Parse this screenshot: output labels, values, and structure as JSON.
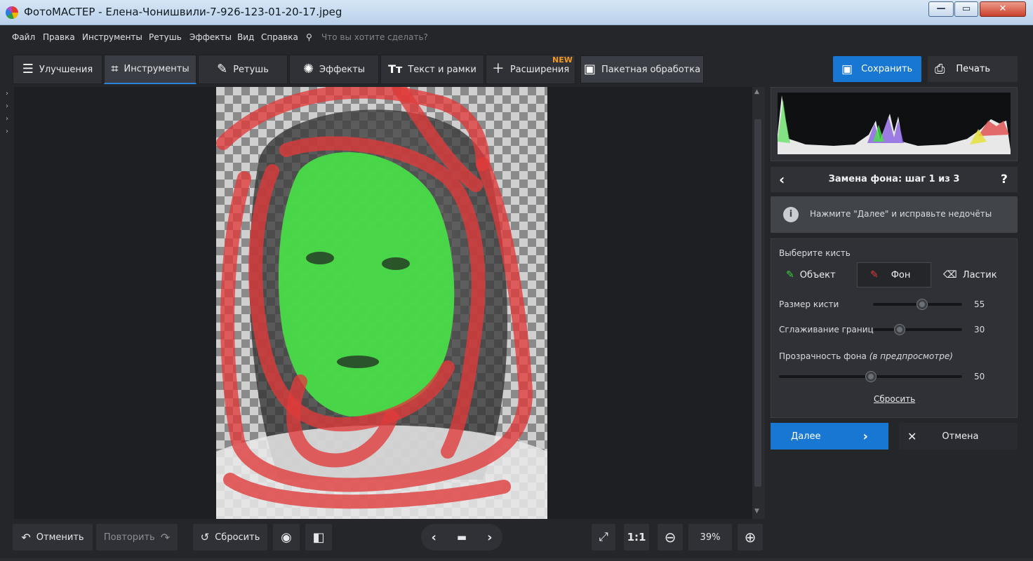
{
  "window": {
    "title": "ФотоМАСТЕР - Елена-Чонишвили-7-926-123-01-20-17.jpeg",
    "min": "—",
    "max": "▭",
    "close": "✕"
  },
  "menu": {
    "items": [
      "Файл",
      "Правка",
      "Инструменты",
      "Ретушь",
      "Эффекты",
      "Вид",
      "Справка"
    ],
    "search_placeholder": "Что вы хотите сделать?"
  },
  "tabs": [
    {
      "label": "Улучшения",
      "icon": "sliders-icon"
    },
    {
      "label": "Инструменты",
      "icon": "crop-icon"
    },
    {
      "label": "Ретушь",
      "icon": "brush-icon"
    },
    {
      "label": "Эффекты",
      "icon": "magic-wand-icon"
    },
    {
      "label": "Текст и рамки",
      "icon": "text-icon"
    },
    {
      "label": "Расширения",
      "icon": "plus-icon"
    },
    {
      "label": "Пакетная обработка",
      "icon": "images-icon"
    }
  ],
  "new_badge": "NEW",
  "save_label": "Сохранить",
  "print_label": "Печать",
  "panel": {
    "step_title": "Замена фона: шаг 1 из 3",
    "back": "‹",
    "help": "?",
    "hint": "Нажмите \"Далее\" и исправьте недочёты",
    "brush_title": "Выберите кисть",
    "brush_object": "Объект",
    "brush_background": "Фон",
    "brush_eraser": "Ластик",
    "size_label": "Размер кисти",
    "size_value": "55",
    "size_fraction": 0.55,
    "smooth_label": "Сглаживание границ",
    "smooth_value": "30",
    "smooth_fraction": 0.3,
    "opacity_label": "Прозрачность фона",
    "opacity_hint": "(в предпросмотре)",
    "opacity_value": "50",
    "opacity_fraction": 0.5,
    "reset_link": "Сбросить",
    "next_label": "Далее",
    "cancel_label": "Отмена"
  },
  "bottom": {
    "undo": "Отменить",
    "redo": "Повторить",
    "reset": "Сбросить",
    "ratio": "1:1",
    "zoom": "39%"
  },
  "colors": {
    "accent": "#1877d2",
    "object_brush": "#3ad13a",
    "background_brush": "#e03a3a",
    "new_badge": "#f39a1e"
  }
}
